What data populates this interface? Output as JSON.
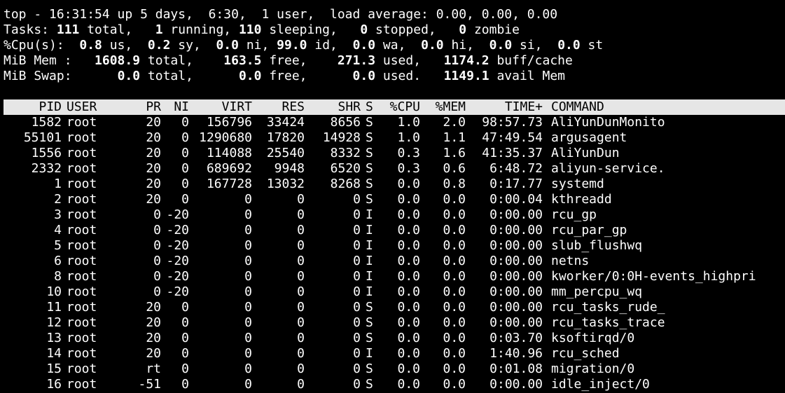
{
  "summary": {
    "line1": "top - 16:31:54 up 5 days,  6:30,  1 user,  load average: 0.00, 0.00, 0.00",
    "tasks": {
      "label": "Tasks: ",
      "total": "111",
      "total_label": " total,   ",
      "running": "1",
      "running_label": " running, ",
      "sleeping": "110",
      "sleeping_label": " sleeping,   ",
      "stopped": "0",
      "stopped_label": " stopped,   ",
      "zombie": "0",
      "zombie_label": " zombie"
    },
    "cpu": {
      "label": "%Cpu(s):  ",
      "us": "0.8",
      "us_label": " us,  ",
      "sy": "0.2",
      "sy_label": " sy,  ",
      "ni": "0.0",
      "ni_label": " ni, ",
      "id": "99.0",
      "id_label": " id,  ",
      "wa": "0.0",
      "wa_label": " wa,  ",
      "hi": "0.0",
      "hi_label": " hi,  ",
      "si": "0.0",
      "si_label": " si,  ",
      "st": "0.0",
      "st_label": " st"
    },
    "mem": {
      "label": "MiB Mem :   ",
      "total": "1608.9",
      "total_label": " total,    ",
      "free": "163.5",
      "free_label": " free,    ",
      "used": "271.3",
      "used_label": " used,   ",
      "buff": "1174.2",
      "buff_label": " buff/cache"
    },
    "swap": {
      "label": "MiB Swap:      ",
      "total": "0.0",
      "total_label": " total,      ",
      "free": "0.0",
      "free_label": " free,      ",
      "used": "0.0",
      "used_label": " used.   ",
      "avail": "1149.1",
      "avail_label": " avail Mem"
    }
  },
  "columns": {
    "pid": "PID",
    "user": "USER",
    "pr": "PR",
    "ni": "NI",
    "virt": "VIRT",
    "res": "RES",
    "shr": "SHR",
    "s": "S",
    "cpu": "%CPU",
    "mem": "%MEM",
    "time": "TIME+",
    "command": "COMMAND"
  },
  "processes": [
    {
      "pid": "1582",
      "user": "root",
      "pr": "20",
      "ni": "0",
      "virt": "156796",
      "res": "33424",
      "shr": "8656",
      "s": "S",
      "cpu": "1.0",
      "mem": "2.0",
      "time": "98:57.73",
      "command": "AliYunDunMonito"
    },
    {
      "pid": "55101",
      "user": "root",
      "pr": "20",
      "ni": "0",
      "virt": "1290680",
      "res": "17820",
      "shr": "14928",
      "s": "S",
      "cpu": "1.0",
      "mem": "1.1",
      "time": "47:49.54",
      "command": "argusagent"
    },
    {
      "pid": "1556",
      "user": "root",
      "pr": "20",
      "ni": "0",
      "virt": "114088",
      "res": "25540",
      "shr": "8332",
      "s": "S",
      "cpu": "0.3",
      "mem": "1.6",
      "time": "41:35.37",
      "command": "AliYunDun"
    },
    {
      "pid": "2332",
      "user": "root",
      "pr": "20",
      "ni": "0",
      "virt": "689692",
      "res": "9948",
      "shr": "6520",
      "s": "S",
      "cpu": "0.3",
      "mem": "0.6",
      "time": "6:48.72",
      "command": "aliyun-service."
    },
    {
      "pid": "1",
      "user": "root",
      "pr": "20",
      "ni": "0",
      "virt": "167728",
      "res": "13032",
      "shr": "8268",
      "s": "S",
      "cpu": "0.0",
      "mem": "0.8",
      "time": "0:17.77",
      "command": "systemd"
    },
    {
      "pid": "2",
      "user": "root",
      "pr": "20",
      "ni": "0",
      "virt": "0",
      "res": "0",
      "shr": "0",
      "s": "S",
      "cpu": "0.0",
      "mem": "0.0",
      "time": "0:00.04",
      "command": "kthreadd"
    },
    {
      "pid": "3",
      "user": "root",
      "pr": "0",
      "ni": "-20",
      "virt": "0",
      "res": "0",
      "shr": "0",
      "s": "I",
      "cpu": "0.0",
      "mem": "0.0",
      "time": "0:00.00",
      "command": "rcu_gp"
    },
    {
      "pid": "4",
      "user": "root",
      "pr": "0",
      "ni": "-20",
      "virt": "0",
      "res": "0",
      "shr": "0",
      "s": "I",
      "cpu": "0.0",
      "mem": "0.0",
      "time": "0:00.00",
      "command": "rcu_par_gp"
    },
    {
      "pid": "5",
      "user": "root",
      "pr": "0",
      "ni": "-20",
      "virt": "0",
      "res": "0",
      "shr": "0",
      "s": "I",
      "cpu": "0.0",
      "mem": "0.0",
      "time": "0:00.00",
      "command": "slub_flushwq"
    },
    {
      "pid": "6",
      "user": "root",
      "pr": "0",
      "ni": "-20",
      "virt": "0",
      "res": "0",
      "shr": "0",
      "s": "I",
      "cpu": "0.0",
      "mem": "0.0",
      "time": "0:00.00",
      "command": "netns"
    },
    {
      "pid": "8",
      "user": "root",
      "pr": "0",
      "ni": "-20",
      "virt": "0",
      "res": "0",
      "shr": "0",
      "s": "I",
      "cpu": "0.0",
      "mem": "0.0",
      "time": "0:00.00",
      "command": "kworker/0:0H-events_highpri"
    },
    {
      "pid": "10",
      "user": "root",
      "pr": "0",
      "ni": "-20",
      "virt": "0",
      "res": "0",
      "shr": "0",
      "s": "I",
      "cpu": "0.0",
      "mem": "0.0",
      "time": "0:00.00",
      "command": "mm_percpu_wq"
    },
    {
      "pid": "11",
      "user": "root",
      "pr": "20",
      "ni": "0",
      "virt": "0",
      "res": "0",
      "shr": "0",
      "s": "S",
      "cpu": "0.0",
      "mem": "0.0",
      "time": "0:00.00",
      "command": "rcu_tasks_rude_"
    },
    {
      "pid": "12",
      "user": "root",
      "pr": "20",
      "ni": "0",
      "virt": "0",
      "res": "0",
      "shr": "0",
      "s": "S",
      "cpu": "0.0",
      "mem": "0.0",
      "time": "0:00.00",
      "command": "rcu_tasks_trace"
    },
    {
      "pid": "13",
      "user": "root",
      "pr": "20",
      "ni": "0",
      "virt": "0",
      "res": "0",
      "shr": "0",
      "s": "S",
      "cpu": "0.0",
      "mem": "0.0",
      "time": "0:03.70",
      "command": "ksoftirqd/0"
    },
    {
      "pid": "14",
      "user": "root",
      "pr": "20",
      "ni": "0",
      "virt": "0",
      "res": "0",
      "shr": "0",
      "s": "I",
      "cpu": "0.0",
      "mem": "0.0",
      "time": "1:40.96",
      "command": "rcu_sched"
    },
    {
      "pid": "15",
      "user": "root",
      "pr": "rt",
      "ni": "0",
      "virt": "0",
      "res": "0",
      "shr": "0",
      "s": "S",
      "cpu": "0.0",
      "mem": "0.0",
      "time": "0:01.08",
      "command": "migration/0"
    },
    {
      "pid": "16",
      "user": "root",
      "pr": "-51",
      "ni": "0",
      "virt": "0",
      "res": "0",
      "shr": "0",
      "s": "S",
      "cpu": "0.0",
      "mem": "0.0",
      "time": "0:00.00",
      "command": "idle_inject/0"
    }
  ]
}
